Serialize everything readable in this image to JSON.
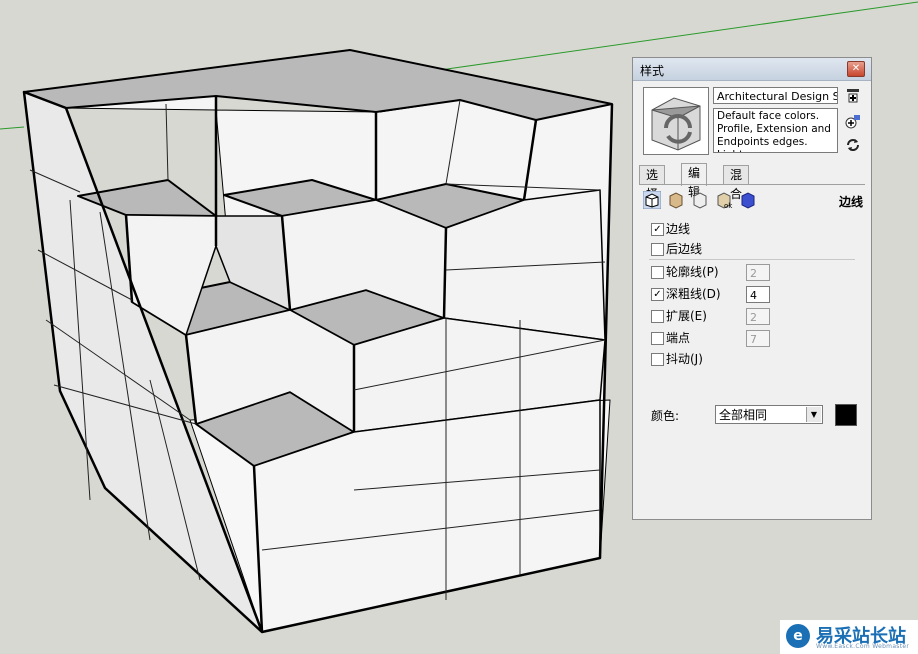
{
  "viewport": {
    "background": "#d8d8d3",
    "axis_color": "#2a9a2a"
  },
  "panel": {
    "title": "样式",
    "close_icon": "close-icon",
    "style_name": "Architectural Design Style",
    "description": "Default face colors. Profile, Extension and Endpoints edges. Light",
    "tabs": [
      "选择",
      "编辑",
      "混合"
    ],
    "active_tab": "编辑",
    "section_label": "边线",
    "edges": [
      {
        "label": "边线",
        "checked": true
      },
      {
        "label": "后边线",
        "checked": false
      }
    ],
    "options": [
      {
        "label": "轮廓线(P)",
        "checked": false,
        "value": "2",
        "enabled": false
      },
      {
        "label": "深粗线(D)",
        "checked": true,
        "value": "4",
        "enabled": true
      },
      {
        "label": "扩展(E)",
        "checked": false,
        "value": "2",
        "enabled": false
      },
      {
        "label": "端点",
        "checked": false,
        "value": "7",
        "enabled": false
      },
      {
        "label": "抖动(J)",
        "checked": false
      }
    ],
    "color_label": "颜色:",
    "color_mode": "全部相同",
    "edge_color": "#000000"
  },
  "watermark": {
    "title": "易采站长站",
    "subtitle": "Www.Easck.Com Webmaster"
  }
}
